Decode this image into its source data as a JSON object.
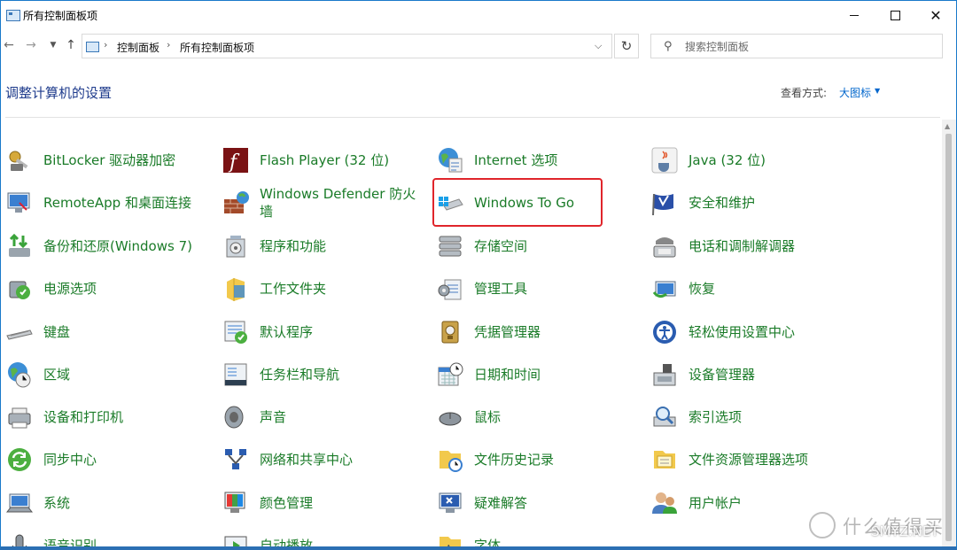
{
  "window": {
    "title": "所有控制面板项"
  },
  "address": {
    "breadcrumbs": [
      "控制面板",
      "所有控制面板项"
    ],
    "search_placeholder": "搜索控制面板"
  },
  "header": {
    "title": "调整计算机的设置",
    "view_label": "查看方式:",
    "view_value": "大图标"
  },
  "items": [
    {
      "label": "BitLocker 驱动器加密",
      "icon": "bitlocker-icon"
    },
    {
      "label": "Flash Player (32 位)",
      "icon": "flash-player-icon"
    },
    {
      "label": "Internet 选项",
      "icon": "internet-options-icon"
    },
    {
      "label": "Java (32 位)",
      "icon": "java-icon"
    },
    {
      "label": "RemoteApp 和桌面连接",
      "icon": "remoteapp-icon"
    },
    {
      "label": "Windows Defender 防火墙",
      "icon": "firewall-icon"
    },
    {
      "label": "Windows To Go",
      "icon": "windows-to-go-icon"
    },
    {
      "label": "安全和维护",
      "icon": "security-maintenance-icon"
    },
    {
      "label": "备份和还原(Windows 7)",
      "icon": "backup-restore-icon"
    },
    {
      "label": "程序和功能",
      "icon": "programs-features-icon"
    },
    {
      "label": "存储空间",
      "icon": "storage-spaces-icon"
    },
    {
      "label": "电话和调制解调器",
      "icon": "phone-modem-icon"
    },
    {
      "label": "电源选项",
      "icon": "power-options-icon"
    },
    {
      "label": "工作文件夹",
      "icon": "work-folders-icon"
    },
    {
      "label": "管理工具",
      "icon": "admin-tools-icon"
    },
    {
      "label": "恢复",
      "icon": "recovery-icon"
    },
    {
      "label": "键盘",
      "icon": "keyboard-icon"
    },
    {
      "label": "默认程序",
      "icon": "default-programs-icon"
    },
    {
      "label": "凭据管理器",
      "icon": "credential-manager-icon"
    },
    {
      "label": "轻松使用设置中心",
      "icon": "ease-of-access-icon"
    },
    {
      "label": "区域",
      "icon": "region-icon"
    },
    {
      "label": "任务栏和导航",
      "icon": "taskbar-icon"
    },
    {
      "label": "日期和时间",
      "icon": "date-time-icon"
    },
    {
      "label": "设备管理器",
      "icon": "device-manager-icon"
    },
    {
      "label": "设备和打印机",
      "icon": "devices-printers-icon"
    },
    {
      "label": "声音",
      "icon": "sound-icon"
    },
    {
      "label": "鼠标",
      "icon": "mouse-icon"
    },
    {
      "label": "索引选项",
      "icon": "indexing-options-icon"
    },
    {
      "label": "同步中心",
      "icon": "sync-center-icon"
    },
    {
      "label": "网络和共享中心",
      "icon": "network-sharing-icon"
    },
    {
      "label": "文件历史记录",
      "icon": "file-history-icon"
    },
    {
      "label": "文件资源管理器选项",
      "icon": "file-explorer-options-icon"
    },
    {
      "label": "系统",
      "icon": "system-icon"
    },
    {
      "label": "颜色管理",
      "icon": "color-management-icon"
    },
    {
      "label": "疑难解答",
      "icon": "troubleshooting-icon"
    },
    {
      "label": "用户帐户",
      "icon": "user-accounts-icon"
    },
    {
      "label": "语音识别",
      "icon": "speech-recognition-icon"
    },
    {
      "label": "自动播放",
      "icon": "autoplay-icon"
    },
    {
      "label": "字体",
      "icon": "fonts-icon"
    }
  ],
  "watermark": {
    "cn": "什么值得买",
    "en": "SMYZ.NET"
  }
}
